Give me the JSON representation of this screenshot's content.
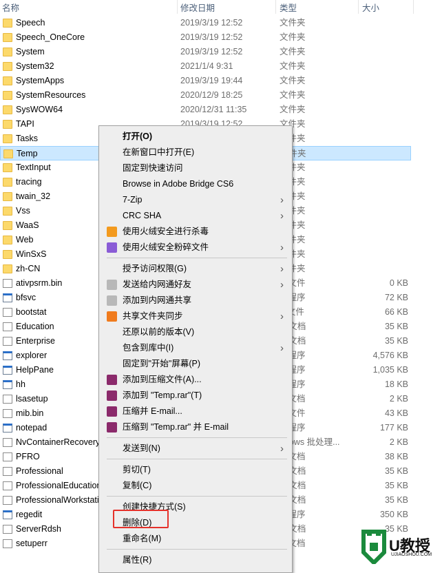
{
  "header": {
    "name": "名称",
    "date": "修改日期",
    "type": "类型",
    "size": "大小"
  },
  "files": [
    {
      "name": "Speech",
      "date": "2019/3/19 12:52",
      "type": "文件夹",
      "size": "",
      "icon": "folder"
    },
    {
      "name": "Speech_OneCore",
      "date": "2019/3/19 12:52",
      "type": "文件夹",
      "size": "",
      "icon": "folder"
    },
    {
      "name": "System",
      "date": "2019/3/19 12:52",
      "type": "文件夹",
      "size": "",
      "icon": "folder"
    },
    {
      "name": "System32",
      "date": "2021/1/4 9:31",
      "type": "文件夹",
      "size": "",
      "icon": "folder"
    },
    {
      "name": "SystemApps",
      "date": "2019/3/19 19:44",
      "type": "文件夹",
      "size": "",
      "icon": "folder"
    },
    {
      "name": "SystemResources",
      "date": "2020/12/9 18:25",
      "type": "文件夹",
      "size": "",
      "icon": "folder"
    },
    {
      "name": "SysWOW64",
      "date": "2020/12/31 11:35",
      "type": "文件夹",
      "size": "",
      "icon": "folder"
    },
    {
      "name": "TAPI",
      "date": "2019/3/19 12:52",
      "type": "文件夹",
      "size": "",
      "icon": "folder"
    },
    {
      "name": "Tasks",
      "date": "",
      "type": "文件夹",
      "size": "",
      "icon": "folder"
    },
    {
      "name": "Temp",
      "date": "",
      "type": "文件夹",
      "size": "",
      "icon": "folder",
      "selected": true
    },
    {
      "name": "TextInput",
      "date": "",
      "type": "文件夹",
      "size": "",
      "icon": "folder"
    },
    {
      "name": "tracing",
      "date": "",
      "type": "文件夹",
      "size": "",
      "icon": "folder"
    },
    {
      "name": "twain_32",
      "date": "",
      "type": "文件夹",
      "size": "",
      "icon": "folder"
    },
    {
      "name": "Vss",
      "date": "",
      "type": "文件夹",
      "size": "",
      "icon": "folder"
    },
    {
      "name": "WaaS",
      "date": "",
      "type": "文件夹",
      "size": "",
      "icon": "folder"
    },
    {
      "name": "Web",
      "date": "",
      "type": "文件夹",
      "size": "",
      "icon": "folder"
    },
    {
      "name": "WinSxS",
      "date": "",
      "type": "文件夹",
      "size": "",
      "icon": "folder"
    },
    {
      "name": "zh-CN",
      "date": "",
      "type": "文件夹",
      "size": "",
      "icon": "folder"
    },
    {
      "name": "ativpsrm.bin",
      "date": "",
      "type": "N 文件",
      "size": "0 KB",
      "icon": "file"
    },
    {
      "name": "bfsvc",
      "date": "",
      "type": "用程序",
      "size": "72 KB",
      "icon": "exe"
    },
    {
      "name": "bootstat",
      "date": "",
      "type": "T 文件",
      "size": "66 KB",
      "icon": "file"
    },
    {
      "name": "Education",
      "date": "",
      "type": "IL 文档",
      "size": "35 KB",
      "icon": "file"
    },
    {
      "name": "Enterprise",
      "date": "",
      "type": "IL 文档",
      "size": "35 KB",
      "icon": "file"
    },
    {
      "name": "explorer",
      "date": "",
      "type": "用程序",
      "size": "4,576 KB",
      "icon": "exe"
    },
    {
      "name": "HelpPane",
      "date": "",
      "type": "用程序",
      "size": "1,035 KB",
      "icon": "exe"
    },
    {
      "name": "hh",
      "date": "",
      "type": "用程序",
      "size": "18 KB",
      "icon": "exe"
    },
    {
      "name": "lsasetup",
      "date": "",
      "type": "本文档",
      "size": "2 KB",
      "icon": "file"
    },
    {
      "name": "mib.bin",
      "date": "",
      "type": "N 文件",
      "size": "43 KB",
      "icon": "file"
    },
    {
      "name": "notepad",
      "date": "",
      "type": "用程序",
      "size": "177 KB",
      "icon": "exe"
    },
    {
      "name": "NvContainerRecovery",
      "date": "",
      "type": "ndows 批处理...",
      "size": "2 KB",
      "icon": "file"
    },
    {
      "name": "PFRO",
      "date": "",
      "type": "本文档",
      "size": "38 KB",
      "icon": "file"
    },
    {
      "name": "Professional",
      "date": "",
      "type": "IL 文档",
      "size": "35 KB",
      "icon": "file"
    },
    {
      "name": "ProfessionalEducation",
      "date": "",
      "type": "IL 文档",
      "size": "35 KB",
      "icon": "file"
    },
    {
      "name": "ProfessionalWorkstation",
      "date": "",
      "type": "IL 文档",
      "size": "35 KB",
      "icon": "file"
    },
    {
      "name": "regedit",
      "date": "",
      "type": "用程序",
      "size": "350 KB",
      "icon": "exe"
    },
    {
      "name": "ServerRdsh",
      "date": "",
      "type": "IL 文档",
      "size": "35 KB",
      "icon": "file"
    },
    {
      "name": "setuperr",
      "date": "",
      "type": "本文档",
      "size": "",
      "icon": "file"
    }
  ],
  "menu": [
    {
      "label": "打开(O)",
      "bold": true
    },
    {
      "label": "在新窗口中打开(E)"
    },
    {
      "label": "固定到快速访问"
    },
    {
      "label": "Browse in Adobe Bridge CS6"
    },
    {
      "label": "7-Zip",
      "submenu": true
    },
    {
      "label": "CRC SHA",
      "submenu": true
    },
    {
      "label": "使用火绒安全进行杀毒",
      "icon": "huorong-shield-icon"
    },
    {
      "label": "使用火绒安全粉碎文件",
      "icon": "huorong-shredder-icon",
      "submenu": true
    },
    {
      "sep": true
    },
    {
      "label": "授予访问权限(G)",
      "submenu": true
    },
    {
      "label": "发送给内网通好友",
      "icon": "neiwangtong-icon",
      "submenu": true
    },
    {
      "label": "添加到内网通共享",
      "icon": "neiwangtong-icon"
    },
    {
      "label": "共享文件夹同步",
      "icon": "sync-s-icon",
      "submenu": true
    },
    {
      "label": "还原以前的版本(V)"
    },
    {
      "label": "包含到库中(I)",
      "submenu": true
    },
    {
      "label": "固定到\"开始\"屏幕(P)"
    },
    {
      "label": "添加到压缩文件(A)...",
      "icon": "winrar-icon"
    },
    {
      "label": "添加到 \"Temp.rar\"(T)",
      "icon": "winrar-icon"
    },
    {
      "label": "压缩并 E-mail...",
      "icon": "winrar-icon"
    },
    {
      "label": "压缩到 \"Temp.rar\" 并 E-mail",
      "icon": "winrar-icon"
    },
    {
      "sep": true
    },
    {
      "label": "发送到(N)",
      "submenu": true
    },
    {
      "sep": true
    },
    {
      "label": "剪切(T)"
    },
    {
      "label": "复制(C)"
    },
    {
      "sep": true
    },
    {
      "label": "创建快捷方式(S)"
    },
    {
      "label": "删除(D)",
      "highlighted": true
    },
    {
      "label": "重命名(M)"
    },
    {
      "sep": true
    },
    {
      "label": "属性(R)"
    }
  ],
  "watermark": {
    "brand": "U教授",
    "site": "UJIAOSHOU.COM"
  },
  "colors": {
    "selection": "#cce8ff",
    "highlight_box": "#e5312a",
    "watermark": "#1a8a3c"
  }
}
